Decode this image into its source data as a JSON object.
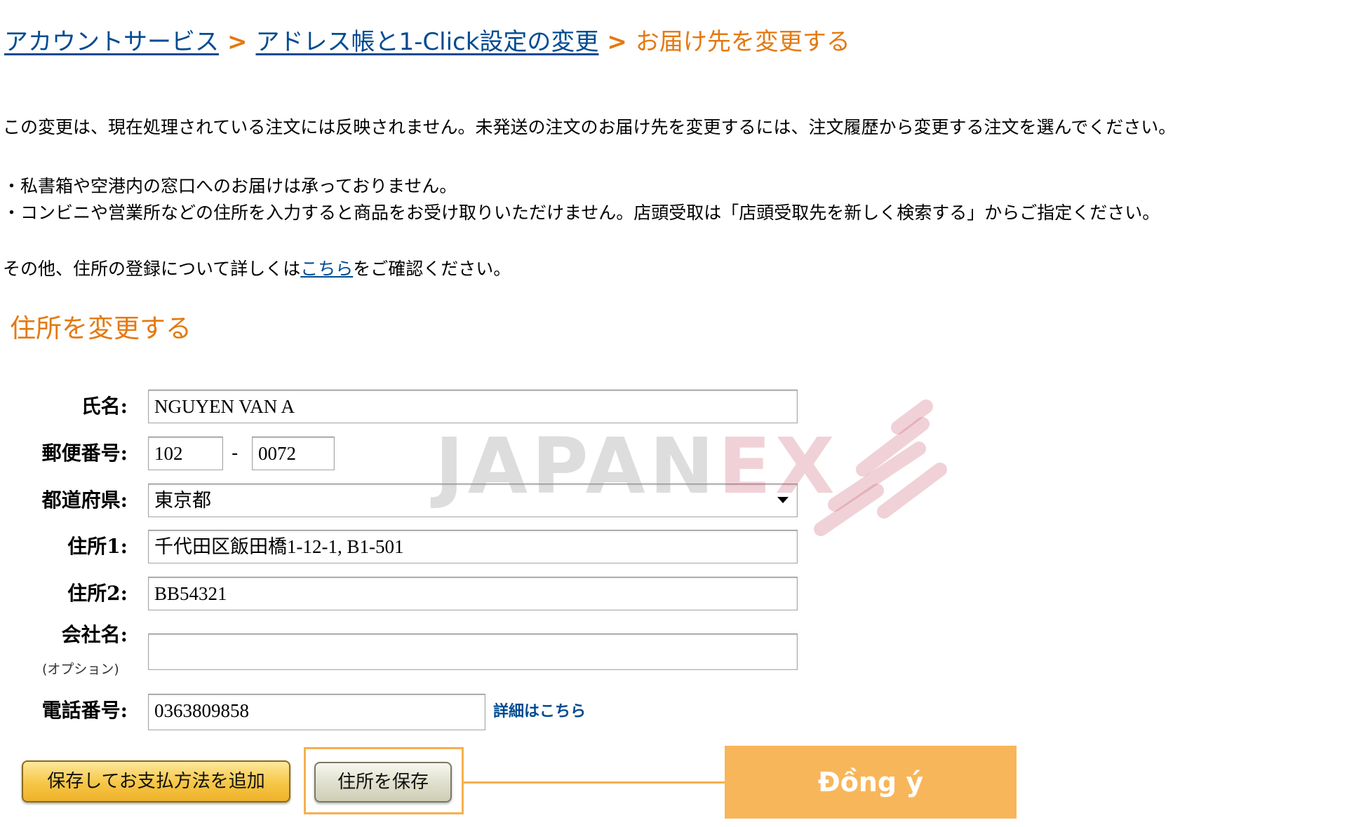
{
  "breadcrumb": {
    "items": [
      "アカウントサービス",
      "アドレス帳と1-Click設定の変更"
    ],
    "separator": ">",
    "current": "お届け先を変更する"
  },
  "notices": {
    "line1": "この変更は、現在処理されている注文には反映されません。未発送の注文のお届け先を変更するには、注文履歴から変更する注文を選んでください。",
    "line2": "・私書箱や空港内の窓口へのお届けは承っておりません。",
    "line3": "・コンビニや営業所などの住所を入力すると商品をお受け取りいただけません。店頭受取は「店頭受取先を新しく検索する」からご指定ください。",
    "line4_prefix": "その他、住所の登録について詳しくは",
    "line4_link": "こちら",
    "line4_suffix": "をご確認ください。"
  },
  "section_title": "住所を変更する",
  "form": {
    "name": {
      "label": "氏名:",
      "value": "NGUYEN VAN A"
    },
    "postal": {
      "label": "郵便番号:",
      "value1": "102",
      "separator": "-",
      "value2": "0072"
    },
    "prefecture": {
      "label": "都道府県:",
      "value": "東京都"
    },
    "address1": {
      "label": "住所1:",
      "value": "千代田区飯田橋1-12-1, B1-501"
    },
    "address2": {
      "label": "住所2:",
      "value": "BB54321"
    },
    "company": {
      "label": "会社名:",
      "sublabel": "(オプション)",
      "value": ""
    },
    "phone": {
      "label": "電話番号:",
      "value": "0363809858",
      "details_link": "詳細はこちら"
    }
  },
  "buttons": {
    "save_add_payment": "保存してお支払方法を追加",
    "save_address": "住所を保存"
  },
  "annotation": {
    "label": "Đồng ý",
    "color": "#f8b65a"
  },
  "watermark": {
    "text_a": "JAPAN",
    "text_b": "EX"
  },
  "colors": {
    "link": "#004b91",
    "accent": "#e47911"
  }
}
